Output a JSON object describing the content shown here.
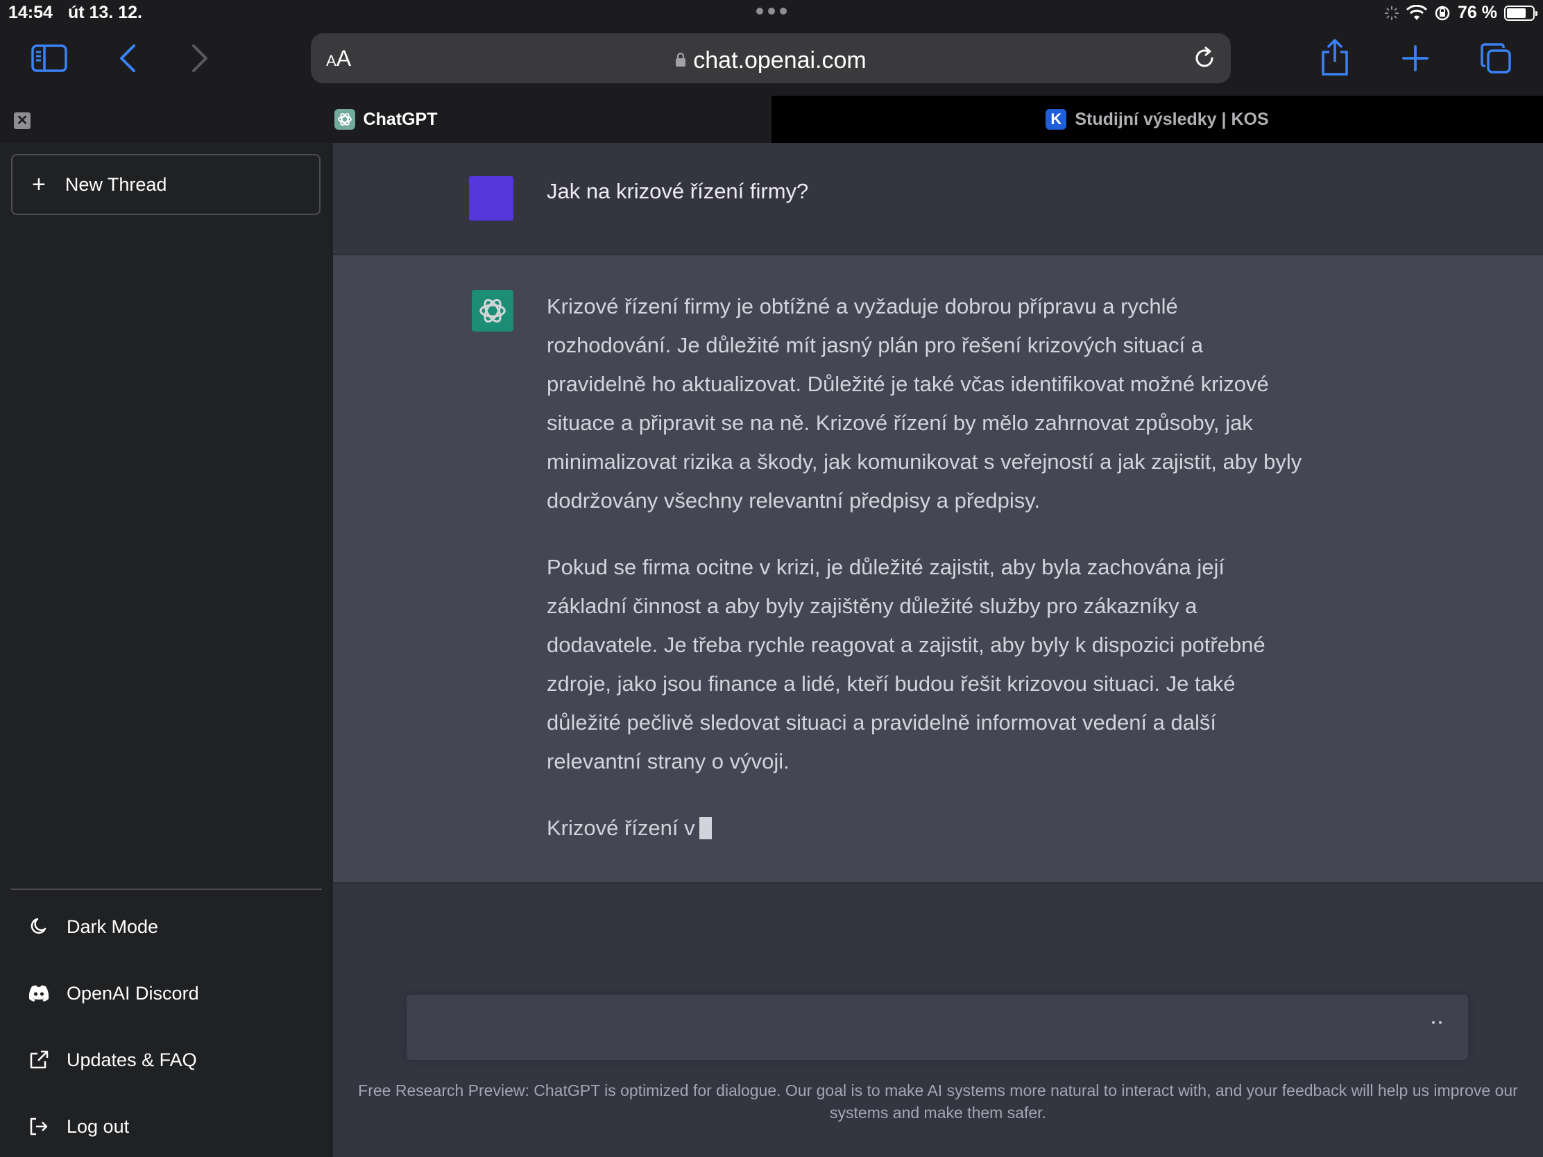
{
  "status_bar": {
    "time": "14:54",
    "date": "út 13. 12.",
    "battery": "76 %",
    "battery_level": 0.76
  },
  "browser": {
    "text_size_label_small": "A",
    "text_size_label_large": "A",
    "url": "chat.openai.com",
    "tabs": [
      {
        "label": "ChatGPT",
        "active": true
      },
      {
        "label": "Studijní výsledky | KOS",
        "active": false,
        "favicon_letter": "K"
      }
    ]
  },
  "sidebar": {
    "new_thread_label": "New Thread",
    "items": [
      {
        "label": "Dark Mode",
        "icon": "moon-icon"
      },
      {
        "label": "OpenAI Discord",
        "icon": "discord-icon"
      },
      {
        "label": "Updates & FAQ",
        "icon": "external-link-icon"
      },
      {
        "label": "Log out",
        "icon": "logout-icon"
      }
    ]
  },
  "conversation": {
    "user_message": "Jak na krizové řízení firmy?",
    "assistant_paragraphs": [
      "Krizové řízení firmy je obtížné a vyžaduje dobrou přípravu a rychlé rozhodování. Je důležité mít jasný plán pro řešení krizových situací a pravidelně ho aktualizovat. Důležité je také včas identifikovat možné krizové situace a připravit se na ně. Krizové řízení by mělo zahrnovat způsoby, jak minimalizovat rizika a škody, jak komunikovat s veřejností a jak zajistit, aby byly dodržovány všechny relevantní předpisy a předpisy.",
      "Pokud se firma ocitne v krizi, je důležité zajistit, aby byla zachována její základní činnost a aby byly zajištěny důležité služby pro zákazníky a dodavatele. Je třeba rychle reagovat a zajistit, aby byly k dispozici potřebné zdroje, jako jsou finance a lidé, kteří budou řešit krizovou situaci. Je také důležité pečlivě sledovat situaci a pravidelně informovat vedení a další relevantní strany o vývoji.",
      "Krizové řízení v"
    ]
  },
  "footer": {
    "note": "Free Research Preview: ChatGPT is optimized for dialogue. Our goal is to make AI systems more natural to interact with, and your feedback will help us improve our systems and make them safer."
  },
  "colors": {
    "sidebar_bg": "#202123",
    "main_bg": "#343541",
    "assistant_bg": "#444654",
    "user_avatar": "#5436da",
    "gpt_green": "#10a37f",
    "ios_blue": "#3b82f6"
  }
}
